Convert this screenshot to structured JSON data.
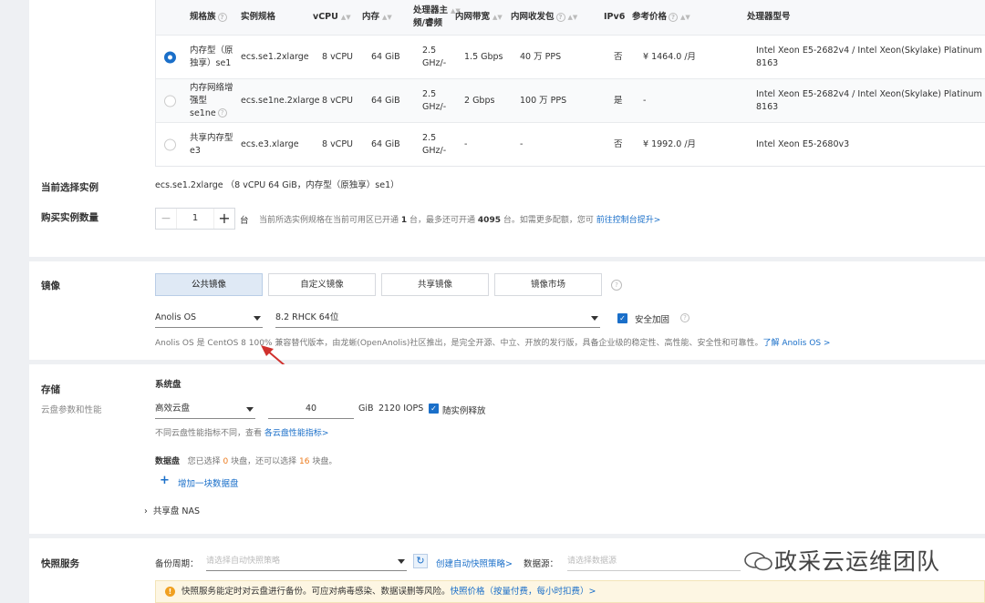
{
  "table": {
    "headers": {
      "family": "规格族",
      "spec": "实例规格",
      "vcpu": "vCPU",
      "mem": "内存",
      "freq_line1": "处理器主",
      "freq_line2": "频/睿频",
      "bandwidth": "内网带宽",
      "pps": "内网收发包",
      "ipv6": "IPv6",
      "price": "参考价格",
      "cpu_model": "处理器型号"
    },
    "rows": [
      {
        "selected": true,
        "family_l1": "内存型（原",
        "family_l2": "独享）se1",
        "family_l3": "",
        "spec": "ecs.se1.2xlarge",
        "vcpu": "8 vCPU",
        "mem": "64 GiB",
        "freq_l1": "2.5",
        "freq_l2": "GHz/-",
        "bandwidth": "1.5 Gbps",
        "pps": "40 万 PPS",
        "ipv6": "否",
        "price_symbol": "¥",
        "price": "1464.0",
        "price_unit": "/月",
        "cpu_model": "Intel Xeon E5-2682v4 / Intel Xeon(Skylake) Platinum 8163"
      },
      {
        "selected": false,
        "family_l1": "内存网络增",
        "family_l2": "强型",
        "family_l3": "se1ne",
        "spec": "ecs.se1ne.2xlarge",
        "vcpu": "8 vCPU",
        "mem": "64 GiB",
        "freq_l1": "2.5",
        "freq_l2": "GHz/-",
        "bandwidth": "2 Gbps",
        "pps": "100 万 PPS",
        "ipv6": "是",
        "price_symbol": "",
        "price": "-",
        "price_unit": "",
        "cpu_model": "Intel Xeon E5-2682v4 / Intel Xeon(Skylake) Platinum 8163"
      },
      {
        "selected": false,
        "family_l1": "共享内存型",
        "family_l2": "e3",
        "family_l3": "",
        "spec": "ecs.e3.xlarge",
        "vcpu": "8 vCPU",
        "mem": "64 GiB",
        "freq_l1": "2.5",
        "freq_l2": "GHz/-",
        "bandwidth": "-",
        "pps": "-",
        "ipv6": "否",
        "price_symbol": "¥",
        "price": "1992.0",
        "price_unit": "/月",
        "cpu_model": "Intel Xeon E5-2680v3"
      }
    ]
  },
  "instance": {
    "current_label": "当前选择实例",
    "current_value": "ecs.se1.2xlarge （8 vCPU 64 GiB，内存型（原独享）se1）",
    "qty_label": "购买实例数量",
    "qty_value": "1",
    "qty_unit": "台",
    "qty_hint_a": "当前所选实例规格在当前可用区已开通",
    "qty_hint_b": "1",
    "qty_hint_c": "台，最多还可开通",
    "qty_hint_d": "4095",
    "qty_hint_e": "台。如需更多配额，您可",
    "qty_link": "前往控制台提升>"
  },
  "image": {
    "section_label": "镜像",
    "tabs": [
      "公共镜像",
      "自定义镜像",
      "共享镜像",
      "镜像市场"
    ],
    "os": "Anolis OS",
    "version": "8.2 RHCK 64位",
    "security_label": "安全加固",
    "desc": "Anolis OS 是 CentOS 8 100% 兼容替代版本，由龙蜥(OpenAnolis)社区推出，是完全开源、中立、开放的发行版，具备企业级的稳定性、高性能、安全性和可靠性。",
    "desc_link": "了解 Anolis OS >"
  },
  "storage": {
    "section_label": "存储",
    "section_sub": "云盘参数和性能",
    "system_disk_label": "系统盘",
    "disk_type": "高效云盘",
    "disk_size": "40",
    "disk_unit": "GiB",
    "iops": "2120 IOPS",
    "release_label": "随实例释放",
    "perf_hint": "不同云盘性能指标不同，查看",
    "perf_link": "各云盘性能指标>",
    "data_disk_label": "数据盘",
    "data_disk_hint_a": "您已选择",
    "data_disk_selected": "0",
    "data_disk_hint_b": "块盘，还可以选择",
    "data_disk_remaining": "16",
    "data_disk_hint_c": "块盘。",
    "add_disk": "增加一块数据盘",
    "nas_label": "共享盘 NAS"
  },
  "snapshot": {
    "section_label": "快照服务",
    "backup_label": "备份周期：",
    "backup_placeholder": "请选择自动快照策略",
    "create_link": "创建自动快照策略>",
    "source_label": "数据源：",
    "source_placeholder": "请选择数据源",
    "notice_text": "快照服务能定时对云盘进行备份。可应对病毒感染、数据误删等风险。",
    "notice_link": "快照价格（按量付费，每小时扣费）>"
  },
  "watermark": "政采云运维团队",
  "colors": {
    "accent": "#1a6fc9",
    "price": "#ec7a1c",
    "arrow": "#d0312d"
  }
}
